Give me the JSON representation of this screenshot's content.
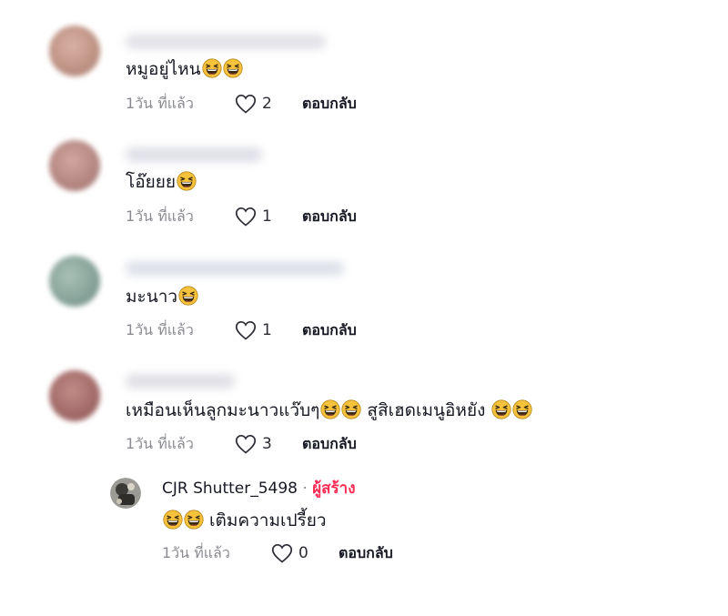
{
  "comments": [
    {
      "text": "หมูอยู่ไหน",
      "emoji_count": 2,
      "time": "1วัน ที่แล้ว",
      "likes": "2",
      "reply_label": "ตอบกลับ",
      "avatar_color": "#c49a8a",
      "username_blur_color": "#c9c9d4"
    },
    {
      "text": "โอ๊ยยย",
      "emoji_count": 1,
      "time": "1วัน ที่แล้ว",
      "likes": "1",
      "reply_label": "ตอบกลับ",
      "avatar_color": "#b98a85",
      "username_blur_color": "#c3c4d2"
    },
    {
      "text": "มะนาว",
      "emoji_count": 1,
      "time": "1วัน ที่แล้ว",
      "likes": "1",
      "reply_label": "ตอบกลับ",
      "avatar_color": "#7f9e94",
      "username_blur_color": "#c0c7d6"
    },
    {
      "text": "เหมือนเห็นลูกมะนาวแว๊บๆ",
      "text_after": " สูสิเฮดเมนูอิหยัง ",
      "emoji_count": 2,
      "emoji_count_after": 2,
      "time": "1วัน ที่แล้ว",
      "likes": "3",
      "reply_label": "ตอบกลับ",
      "avatar_color": "#a06a68",
      "username_blur_color": "#c6c6d0"
    }
  ],
  "reply": {
    "username": "CJR Shutter_5498",
    "separator": " · ",
    "creator_label": "ผู้สร้าง",
    "text": " เติมความเปรี้ยว",
    "emoji_count": 2,
    "time": "1วัน ที่แล้ว",
    "likes": "0",
    "reply_label": "ตอบกลับ"
  },
  "colors": {
    "creator_badge": "#fe2c55",
    "emoji_face": "#f7c23b",
    "timestamp": "#8a8b91"
  },
  "icons": {
    "like": "heart-outline-icon",
    "emoji": "grinning-squinting-face-emoji"
  }
}
